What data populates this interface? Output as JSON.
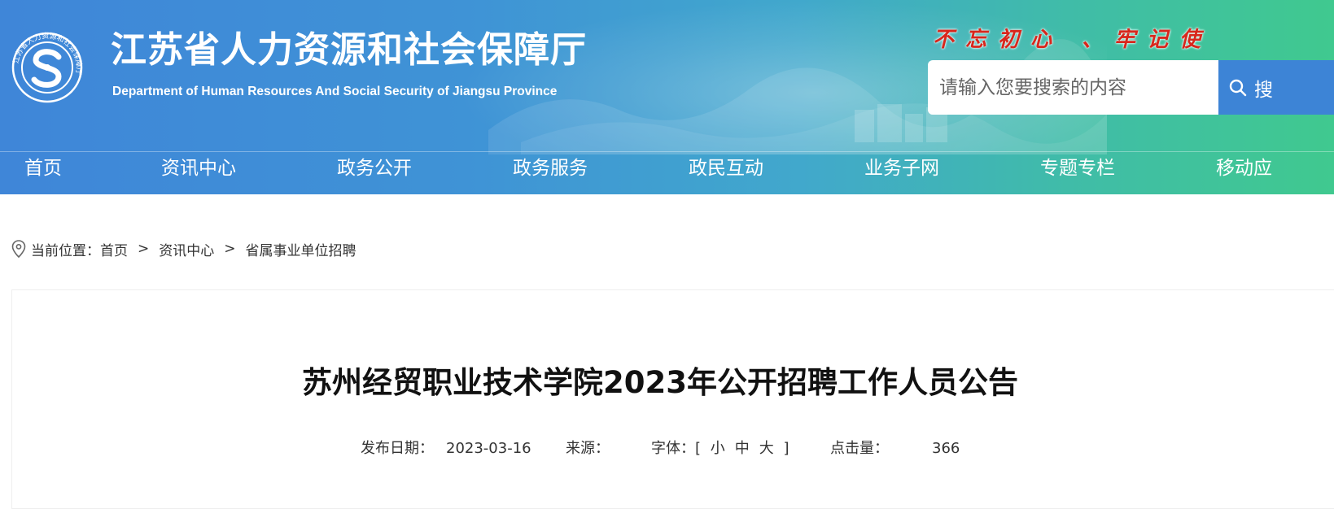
{
  "header": {
    "logo_ring_text": "江苏省人力资源和社会保障厅",
    "title": "江苏省人力资源和社会保障厅",
    "subtitle": "Department of Human Resources And Social Security of Jiangsu Province",
    "slogan": "不忘初心 、牢记使",
    "search": {
      "placeholder": "请输入您要搜索的内容",
      "button_label": "搜"
    }
  },
  "nav": {
    "items": [
      "首页",
      "资讯中心",
      "政务公开",
      "政务服务",
      "政民互动",
      "业务子网",
      "专题专栏",
      "移动应"
    ]
  },
  "breadcrumb": {
    "label": "当前位置：",
    "items": [
      "首页",
      "资讯中心",
      "省属事业单位招聘"
    ],
    "separator": ">"
  },
  "article": {
    "title": "苏州经贸职业技术学院2023年公开招聘工作人员公告",
    "meta": {
      "date_label": "发布日期：",
      "date": "2023-03-16",
      "source_label": "来源：",
      "source": "",
      "font_label": "字体：",
      "font_bracket_open": "[",
      "font_sizes": [
        "小",
        "中",
        "大"
      ],
      "font_bracket_close": "]",
      "hits_label": "点击量：",
      "hits": "366"
    }
  },
  "colors": {
    "header_start": "#3f86d8",
    "header_end": "#40c98f",
    "slogan": "#d8261c",
    "search_button": "#3d84d6"
  },
  "icons": {
    "logo": "hrss-logo-icon",
    "search": "search-icon",
    "location": "location-pin-icon"
  }
}
